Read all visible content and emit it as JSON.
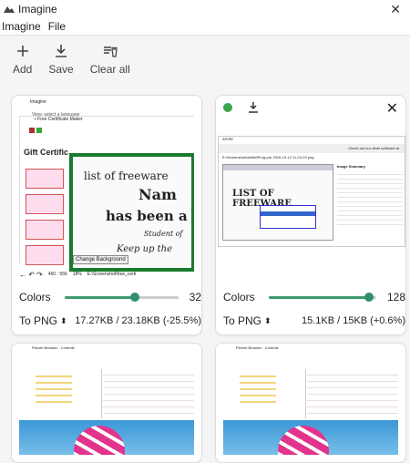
{
  "app": {
    "title": "Imagine",
    "close": "✕"
  },
  "menu": [
    "Imagine",
    "File"
  ],
  "toolbar": {
    "add": "Add",
    "save": "Save",
    "clear": "Clear all"
  },
  "cards": [
    {
      "thumb_title": "Imagine",
      "thumb_caption": "View, select a language",
      "thumb_texts": {
        "gift": "Gift Certific",
        "list": "list of freeware",
        "nam": "Nam",
        "been": "has been a",
        "student": "Student of",
        "keep": "Keep up the",
        "change": "Change Background",
        "status_dims": "450 : 556",
        "status_zoom": "18%",
        "status_path": "E:\\Screenshot\\free_certi"
      },
      "colors_label": "Colors",
      "colors_value": "32",
      "colors_level": 0.62,
      "format": "To PNG",
      "size": "17.27KB / 23.18KB (-25.5%)"
    },
    {
      "thumb_title": "APIRE",
      "thumb_texts": {
        "top": "Check out our other software at",
        "path": "E:\\Screenshot\\old\\list\\Prog-pre 2016-10-12 11-24-23.png",
        "list": "LIST OF FREEWARE",
        "summary": "Image Summary"
      },
      "colors_label": "Colors",
      "colors_value": "128",
      "colors_level": 0.93,
      "format": "To PNG",
      "size": "15.1KB / 15KB (+0.6%)"
    },
    {
      "thumb_title": "Picture Browser - Controls"
    },
    {
      "thumb_title": "Picture Browser - Controls"
    }
  ]
}
